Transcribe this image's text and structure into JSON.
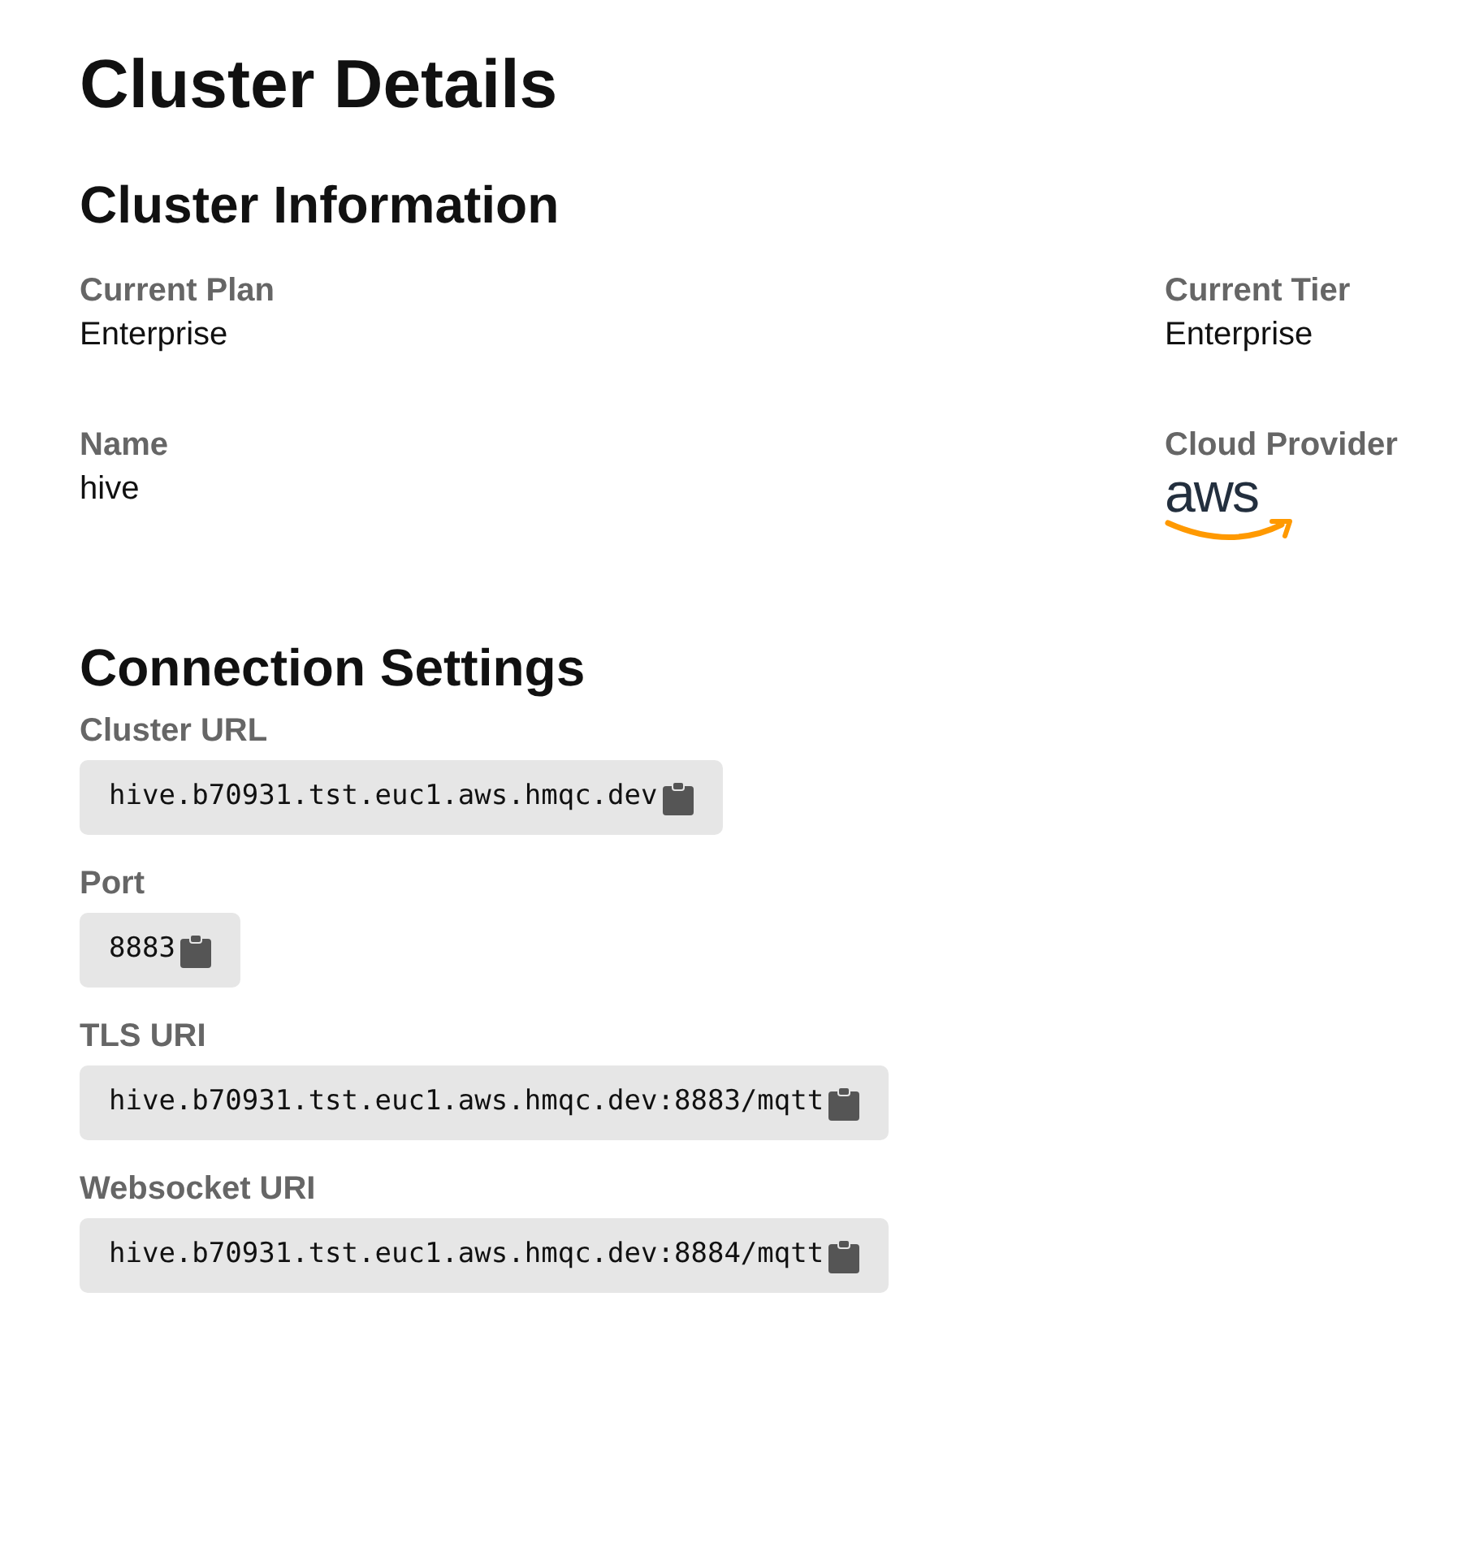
{
  "title": "Cluster Details",
  "cluster_information": {
    "heading": "Cluster Information",
    "fields": [
      {
        "label": "Current Plan",
        "value": "Enterprise"
      },
      {
        "label": "Current Tier",
        "value": "Enterprise"
      },
      {
        "label": "Name",
        "value": "hive"
      },
      {
        "label": "Cloud Provider",
        "kind": "logo",
        "value": "aws"
      }
    ]
  },
  "connection_settings": {
    "heading": "Connection Settings",
    "fields": [
      {
        "label": "Cluster URL",
        "value": "hive.b70931.tst.euc1.aws.hmqc.dev"
      },
      {
        "label": "Port",
        "value": "8883"
      },
      {
        "label": "TLS URI",
        "value": "hive.b70931.tst.euc1.aws.hmqc.dev:8883/mqtt"
      },
      {
        "label": "Websocket URI",
        "value": "hive.b70931.tst.euc1.aws.hmqc.dev:8884/mqtt"
      }
    ]
  }
}
